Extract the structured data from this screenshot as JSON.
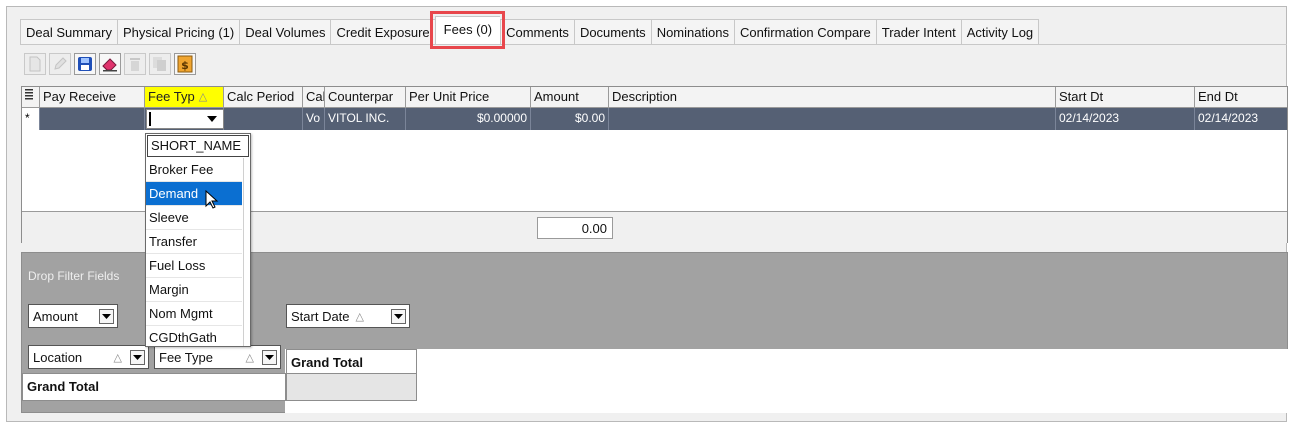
{
  "tabs": [
    {
      "label": "Deal Summary"
    },
    {
      "label": "Physical Pricing (1)"
    },
    {
      "label": "Deal Volumes"
    },
    {
      "label": "Credit Exposure"
    },
    {
      "label": "Fees (0)",
      "active": true
    },
    {
      "label": "Comments"
    },
    {
      "label": "Documents"
    },
    {
      "label": "Nominations"
    },
    {
      "label": "Confirmation Compare"
    },
    {
      "label": "Trader Intent"
    },
    {
      "label": "Activity Log"
    }
  ],
  "toolbar": {
    "icons": [
      "new-icon",
      "edit-icon",
      "save-icon",
      "eraser-icon",
      "delete-icon",
      "copy-icon",
      "document-dollar-icon"
    ]
  },
  "grid": {
    "columns": [
      "Pay Receive",
      "Fee Typ",
      "Calc Period",
      "Cal",
      "Counterpar",
      "Per Unit Price",
      "Amount",
      "Description",
      "Start Dt",
      "End Dt"
    ],
    "new_row_marker": "*",
    "row": {
      "pay_receive": "",
      "fee_type": "",
      "calc_period": "",
      "cal": "Vo",
      "counterparty": "VITOL INC.",
      "per_unit_price": "$0.00000",
      "amount": "$0.00",
      "description": "",
      "start_dt": "02/14/2023",
      "end_dt": "02/14/2023"
    },
    "total": "0.00"
  },
  "fee_dropdown": {
    "header": "SHORT_NAME",
    "items": [
      "Broker Fee",
      "Demand",
      "Sleeve",
      "Transfer",
      "Fuel Loss",
      "Margin",
      "Nom Mgmt",
      "CGDthGath"
    ],
    "selected": "Demand"
  },
  "pivot": {
    "drop_filter_label": "Drop Filter Fields",
    "data_field": "Amount",
    "column_field": "Start Date",
    "row_fields": [
      "Location",
      "Fee Type"
    ],
    "grand_total_col": "Grand Total",
    "grand_total_row": "Grand Total"
  },
  "colors": {
    "active_tab_highlight": "#e8474c",
    "selected_row": "#556074",
    "sorted_header": "#ffff00",
    "dropdown_selected": "#0b6fd1"
  }
}
